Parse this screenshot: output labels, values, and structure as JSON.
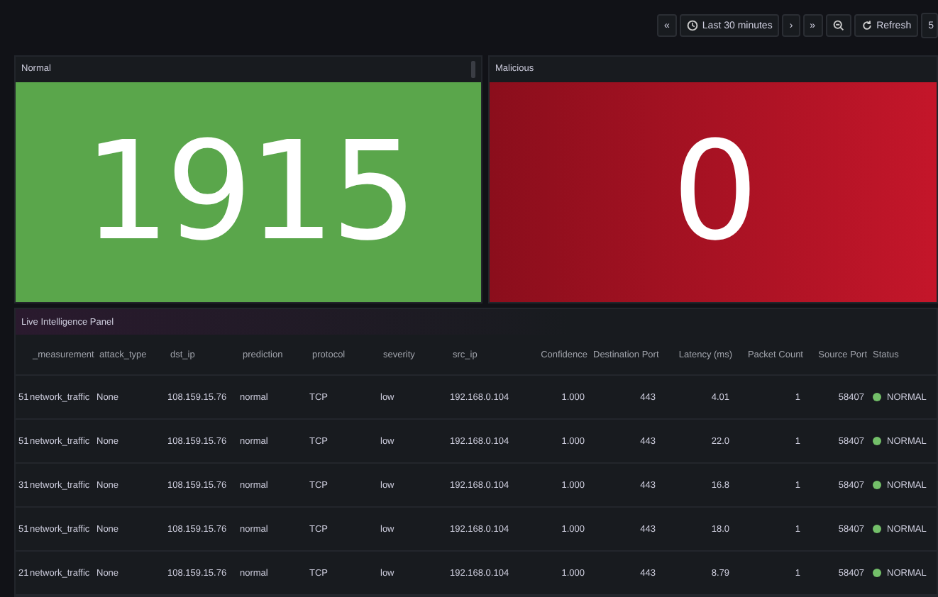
{
  "toolbar": {
    "back": "«",
    "time_range": "Last 30 minutes",
    "caret": "›",
    "forward": "»",
    "refresh": "Refresh",
    "refresh_interval": "5"
  },
  "stats": [
    {
      "title": "Normal",
      "value": "1915",
      "kind": "green"
    },
    {
      "title": "Malicious",
      "value": "0",
      "kind": "red"
    }
  ],
  "table": {
    "title": "Live Intelligence Panel",
    "columns": [
      "_measurement",
      "attack_type",
      "dst_ip",
      "prediction",
      "protocol",
      "severity",
      "src_ip",
      "Confidence",
      "Destination Port",
      "Latency (ms)",
      "Packet Count",
      "Source Port",
      "Status"
    ],
    "rows": [
      {
        "column_1": "51",
        "cells": [
          "network_traffic",
          "None",
          "108.159.15.76",
          "normal",
          "TCP",
          "low",
          "192.168.0.104",
          "1.000",
          "443",
          "4.01",
          "1",
          "58407"
        ],
        "status": {
          "label": "NORMAL",
          "color": "#73bf69"
        }
      },
      {
        "column_1": "51",
        "cells": [
          "network_traffic",
          "None",
          "108.159.15.76",
          "normal",
          "TCP",
          "low",
          "192.168.0.104",
          "1.000",
          "443",
          "22.0",
          "1",
          "58407"
        ],
        "status": {
          "label": "NORMAL",
          "color": "#73bf69"
        }
      },
      {
        "column_1": "31",
        "cells": [
          "network_traffic",
          "None",
          "108.159.15.76",
          "normal",
          "TCP",
          "low",
          "192.168.0.104",
          "1.000",
          "443",
          "16.8",
          "1",
          "58407"
        ],
        "status": {
          "label": "NORMAL",
          "color": "#73bf69"
        }
      },
      {
        "column_1": "51",
        "cells": [
          "network_traffic",
          "None",
          "108.159.15.76",
          "normal",
          "TCP",
          "low",
          "192.168.0.104",
          "1.000",
          "443",
          "18.0",
          "1",
          "58407"
        ],
        "status": {
          "label": "NORMAL",
          "color": "#73bf69"
        }
      },
      {
        "column_1": "21",
        "cells": [
          "network_traffic",
          "None",
          "108.159.15.76",
          "normal",
          "TCP",
          "low",
          "192.168.0.104",
          "1.000",
          "443",
          "8.79",
          "1",
          "58407"
        ],
        "status": {
          "label": "NORMAL",
          "color": "#73bf69"
        }
      }
    ]
  }
}
